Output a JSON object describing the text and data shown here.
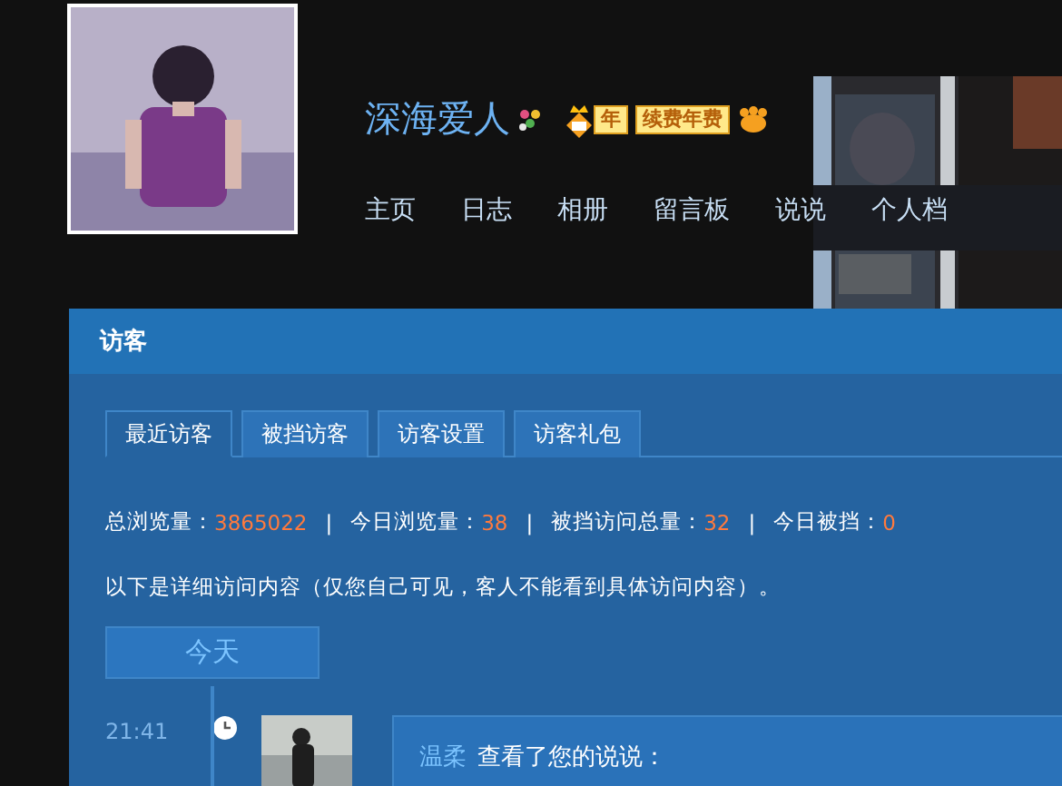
{
  "profile": {
    "name": "深海爱人",
    "badges": [
      {
        "kind": "flower"
      },
      {
        "kind": "level",
        "label": "年"
      },
      {
        "kind": "renew",
        "label": "续费年费"
      },
      {
        "kind": "paw"
      }
    ]
  },
  "nav": [
    {
      "label": "主页"
    },
    {
      "label": "日志"
    },
    {
      "label": "相册"
    },
    {
      "label": "留言板"
    },
    {
      "label": "说说"
    },
    {
      "label": "个人档"
    }
  ],
  "panel": {
    "title": "访客",
    "tabs": [
      {
        "label": "最近访客",
        "selected": true
      },
      {
        "label": "被挡访客",
        "selected": false
      },
      {
        "label": "访客设置",
        "selected": false
      },
      {
        "label": "访客礼包",
        "selected": false
      }
    ],
    "stats_separator": "|",
    "stats": [
      {
        "label": "总浏览量：",
        "value": "3865022"
      },
      {
        "label": "今日浏览量：",
        "value": "38"
      },
      {
        "label": "被挡访问总量：",
        "value": "32"
      },
      {
        "label": "今日被挡：",
        "value": "0"
      }
    ],
    "notice": "以下是详细访问内容（仅您自己可见，客人不能看到具体访问内容）。",
    "timeline": {
      "day": "今天",
      "entries": [
        {
          "time": "21:41",
          "visitor": "温柔",
          "action": "查看了您的说说："
        }
      ]
    }
  }
}
